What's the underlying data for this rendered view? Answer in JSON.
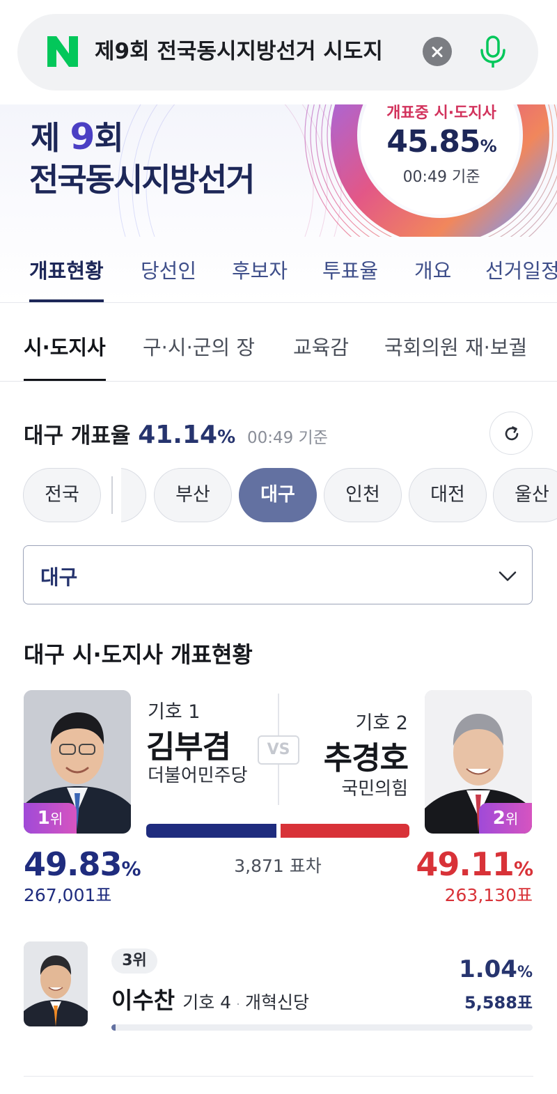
{
  "search": {
    "query": "제9회 전국동시지방선거 시도지",
    "logo": "N",
    "logo_color": "#03c75a",
    "clear_icon": "close-icon",
    "mic_icon": "microphone-icon"
  },
  "banner": {
    "title_prefix": "제",
    "title_number": "9",
    "title_suffix": "회",
    "title_line2": "전국동시지방선거",
    "counting_label": "개표중 시·도지사",
    "counting_rate": "45.85",
    "counting_unit": "%",
    "counting_time": "00:49 기준"
  },
  "main_tabs": [
    "개표현황",
    "당선인",
    "후보자",
    "투표율",
    "개요",
    "선거일정"
  ],
  "sub_tabs": [
    "시·도지사",
    "구·시·군의 장",
    "교육감",
    "국회의원 재·보궐"
  ],
  "count_rate": {
    "label": "대구 개표율",
    "value": "41.14",
    "unit": "%",
    "time": "00:49 기준",
    "refresh_icon": "refresh-icon"
  },
  "regions": [
    "전국",
    "",
    "부산",
    "대구",
    "인천",
    "대전",
    "울산"
  ],
  "selected_region": "대구",
  "section_title": "대구 시·도지사 개표현황",
  "candidates": {
    "first": {
      "rank": "1",
      "rank_suffix": "위",
      "number": "기호 1",
      "name": "김부겸",
      "party": "더불어민주당",
      "percent": "49.83",
      "votes": "267,001표",
      "color": "#1f2c7e",
      "share": 49.83
    },
    "second": {
      "rank": "2",
      "rank_suffix": "위",
      "number": "기호 2",
      "name": "추경호",
      "party": "국민의힘",
      "percent": "49.11",
      "votes": "263,130표",
      "color": "#d83238",
      "share": 49.11
    },
    "vs_label": "VS",
    "gap_text": "3,871 표차",
    "third": {
      "rank": "3위",
      "name": "이수찬",
      "number": "기호 4",
      "separator": "·",
      "party": "개혁신당",
      "percent": "1.04",
      "votes": "5,588표",
      "share": 1.04
    },
    "percent_unit": "%"
  }
}
